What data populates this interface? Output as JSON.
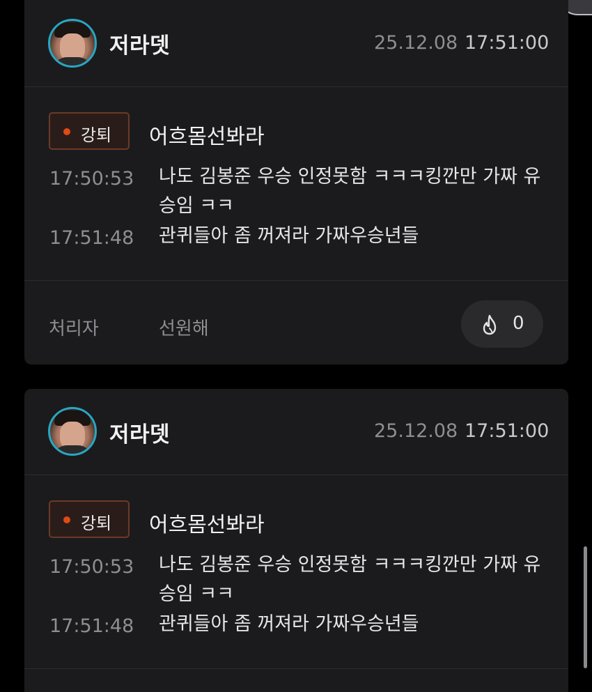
{
  "cards": [
    {
      "username": "저라뎃",
      "date": "25.12.08",
      "time": "17:51:00",
      "tag": "강퇴",
      "target": "어흐몸선봐라",
      "logs": [
        {
          "time": "17:50:53",
          "text": "나도 김봉준 우승 인정못함 ㅋㅋㅋ킹깐만 가짜 유승임 ㅋㅋ"
        },
        {
          "time": "17:51:48",
          "text": "관퀴들아 좀 꺼져라 가짜우승년들"
        }
      ],
      "handler_label": "처리자",
      "handler_name": "선원해",
      "fire_count": "0"
    },
    {
      "username": "저라뎃",
      "date": "25.12.08",
      "time": "17:51:00",
      "tag": "강퇴",
      "target": "어흐몸선봐라",
      "logs": [
        {
          "time": "17:50:53",
          "text": "나도 김봉준 우승 인정못함 ㅋㅋㅋ킹깐만 가짜 유승임 ㅋㅋ"
        },
        {
          "time": "17:51:48",
          "text": "관퀴들아 좀 꺼져라 가짜우승년들"
        }
      ]
    }
  ],
  "icons": {
    "fire": "fire-icon",
    "tag_dot": "status-dot-icon"
  },
  "colors": {
    "background": "#000000",
    "card": "#1b1b1d",
    "avatar_ring": "#27a7c4",
    "tag_dot": "#e04a16",
    "tag_border": "#6b3a28",
    "muted_text": "#8e8e93",
    "primary_text": "#f1f1f1"
  }
}
